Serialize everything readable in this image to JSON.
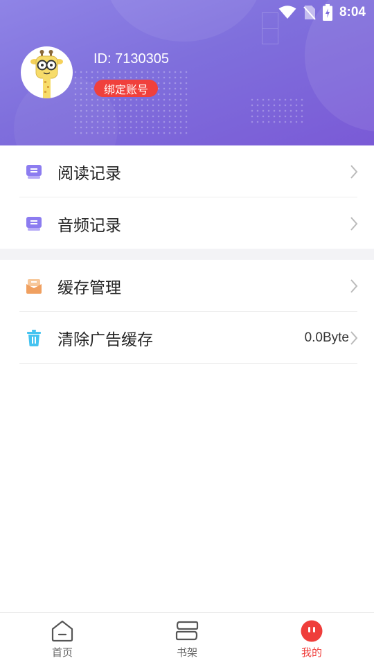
{
  "status_bar": {
    "time": "8:04"
  },
  "profile": {
    "id_text": "ID: 7130305",
    "bind_label": "绑定账号"
  },
  "menu": {
    "group1": [
      {
        "label": "阅读记录",
        "icon": "reading-record-icon"
      },
      {
        "label": "音频记录",
        "icon": "audio-record-icon"
      }
    ],
    "group2": [
      {
        "label": "缓存管理",
        "icon": "cache-manage-icon"
      },
      {
        "label": "清除广告缓存",
        "icon": "trash-icon",
        "value": "0.0Byte"
      }
    ]
  },
  "bottom_nav": [
    {
      "label": "首页",
      "icon": "home-icon",
      "active": false
    },
    {
      "label": "书架",
      "icon": "bookshelf-icon",
      "active": false
    },
    {
      "label": "我的",
      "icon": "profile-face-icon",
      "active": true
    }
  ],
  "colors": {
    "header_gradient_start": "#8f84e6",
    "header_gradient_end": "#7a5ad6",
    "accent_red": "#ef3e3b",
    "menu_icon_purple": "#8c7cf0",
    "cache_icon_orange": "#f0a060",
    "trash_icon_blue": "#45c3f0"
  }
}
